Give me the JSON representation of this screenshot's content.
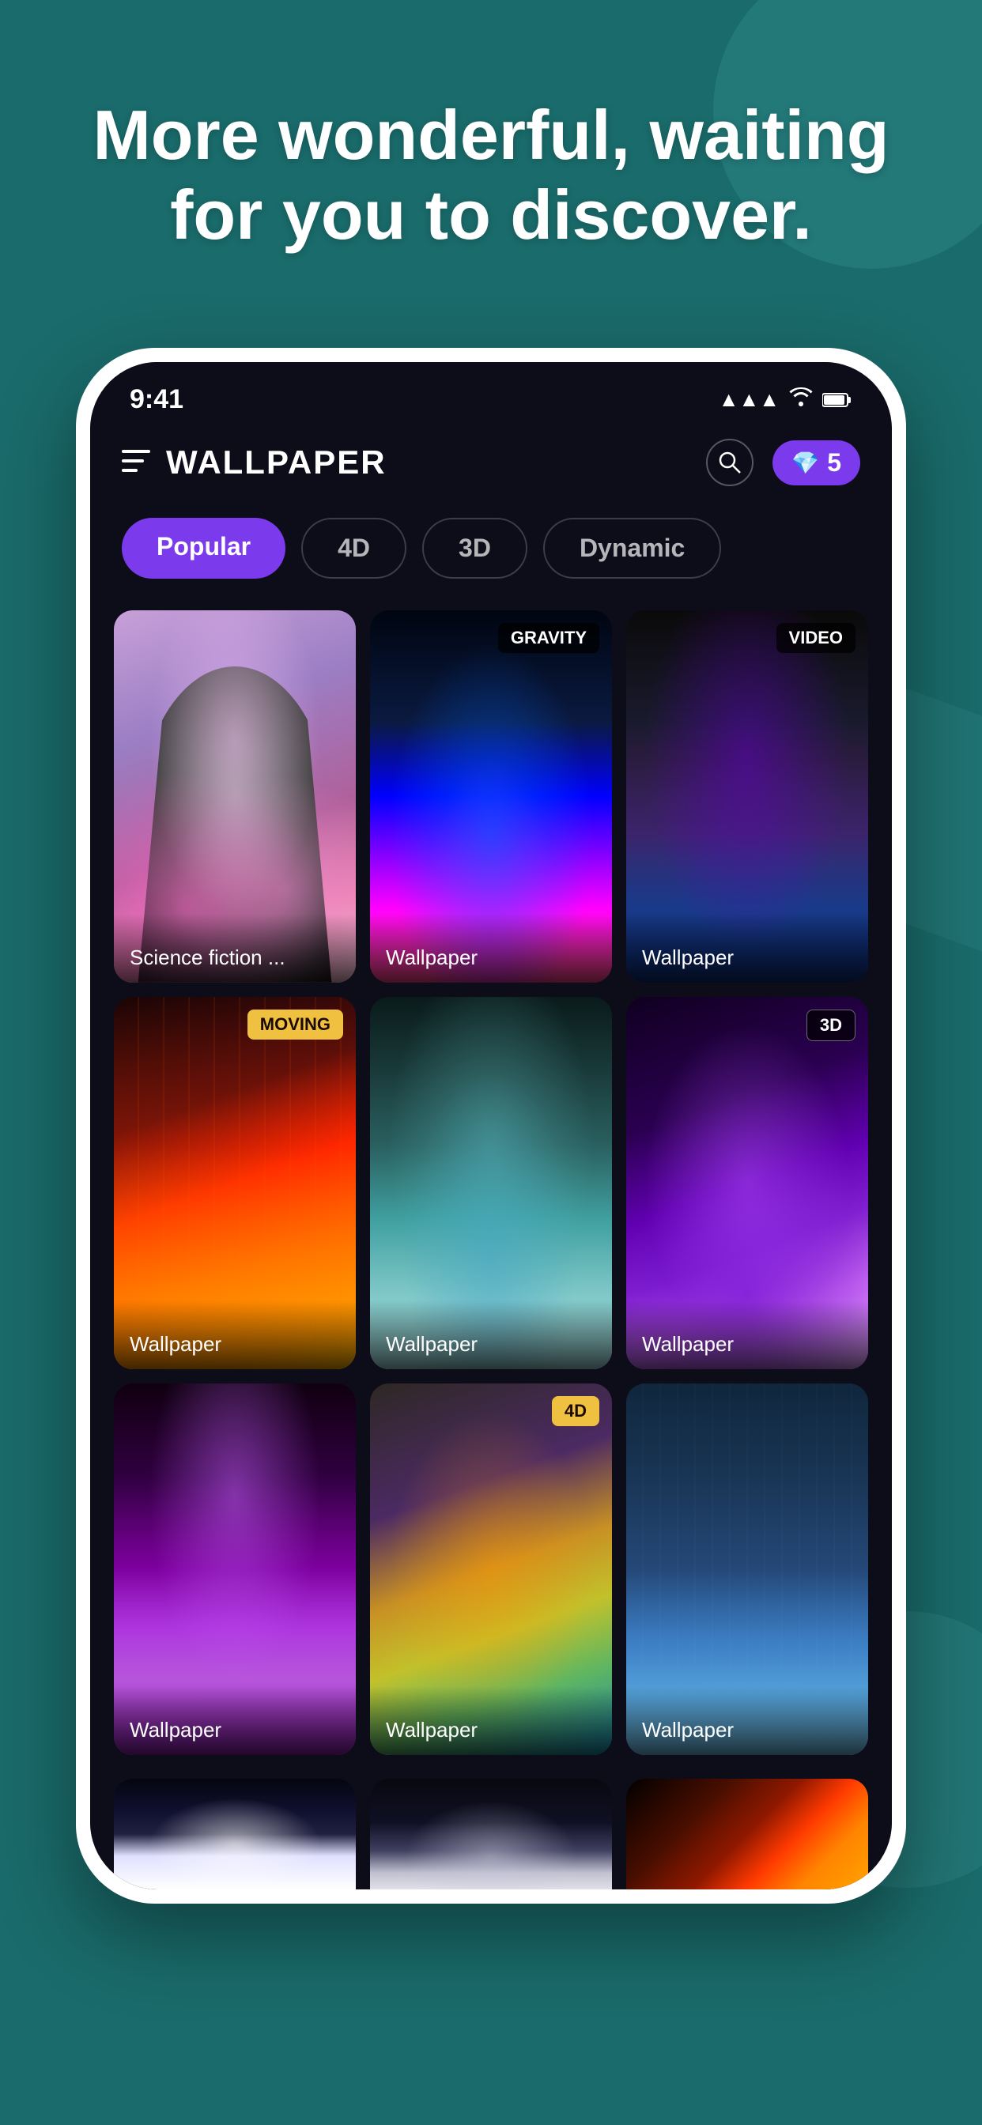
{
  "background": {
    "color": "#1a6b6b"
  },
  "hero": {
    "title": "More wonderful, waiting for you to discover."
  },
  "status_bar": {
    "time": "9:41",
    "signal": "▲▲▲",
    "wifi": "WiFi",
    "battery": "Battery"
  },
  "app_header": {
    "menu_icon": "≡",
    "title": "WALLPAPER",
    "gems_count": "5"
  },
  "categories": [
    {
      "label": "Popular",
      "active": true
    },
    {
      "label": "4D",
      "active": false
    },
    {
      "label": "3D",
      "active": false
    },
    {
      "label": "Dynamic",
      "active": false
    }
  ],
  "wallpapers": [
    {
      "id": 1,
      "title": "Science fiction ...",
      "badge": null,
      "badge_type": null
    },
    {
      "id": 2,
      "title": "Wallpaper",
      "badge": "GRAVITY",
      "badge_type": "gravity"
    },
    {
      "id": 3,
      "title": "Wallpaper",
      "badge": "VIDEO",
      "badge_type": "video"
    },
    {
      "id": 4,
      "title": "Wallpaper",
      "badge": "MOVING",
      "badge_type": "moving"
    },
    {
      "id": 5,
      "title": "Wallpaper",
      "badge": null,
      "badge_type": null
    },
    {
      "id": 6,
      "title": "Wallpaper",
      "badge": "3D",
      "badge_type": "3d"
    },
    {
      "id": 7,
      "title": "Wallpaper",
      "badge": null,
      "badge_type": null
    },
    {
      "id": 8,
      "title": "Wallpaper",
      "badge": "4D",
      "badge_type": "4d"
    },
    {
      "id": 9,
      "title": "Wallpaper",
      "badge": null,
      "badge_type": null
    },
    {
      "id": 10,
      "title": "",
      "badge": null,
      "badge_type": null
    },
    {
      "id": 11,
      "title": "",
      "badge": null,
      "badge_type": null
    },
    {
      "id": 12,
      "title": "",
      "badge": null,
      "badge_type": null
    }
  ]
}
